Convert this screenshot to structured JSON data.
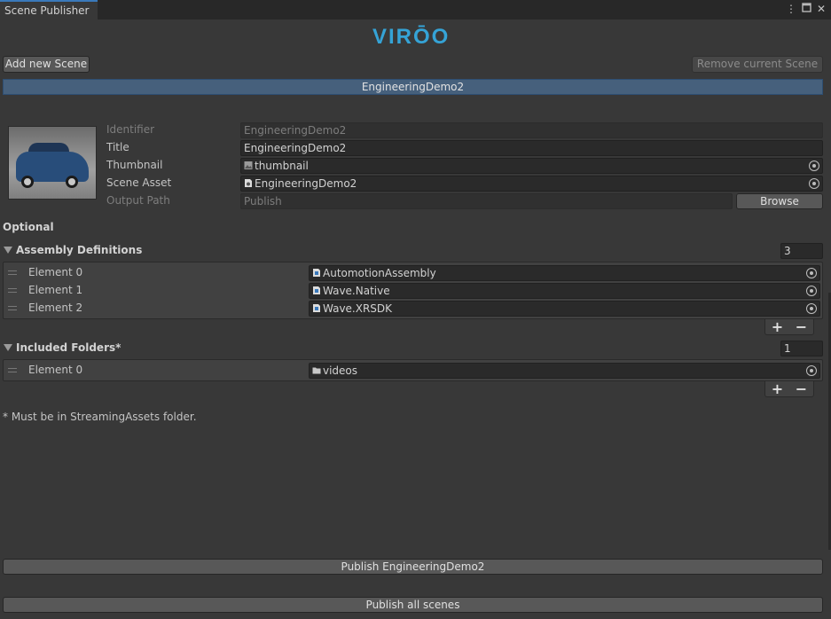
{
  "window": {
    "tab_label": "Scene Publisher",
    "menu_icon": "kebab-icon",
    "maximize_icon": "maximize-icon",
    "close_icon": "close-icon"
  },
  "logo": {
    "text": "VIRŌO",
    "color": "#35a3d6"
  },
  "toolbar": {
    "add_label": "Add new Scene",
    "remove_label": "Remove current Scene"
  },
  "scene_list": {
    "selected": "EngineeringDemo2"
  },
  "form": {
    "identifier_label": "Identifier",
    "identifier_value": "EngineeringDemo2",
    "title_label": "Title",
    "title_value": "EngineeringDemo2",
    "thumbnail_label": "Thumbnail",
    "thumbnail_value": "thumbnail",
    "scene_asset_label": "Scene Asset",
    "scene_asset_value": "EngineeringDemo2",
    "output_path_label": "Output Path",
    "output_path_placeholder": "Publish",
    "browse_label": "Browse"
  },
  "optional_label": "Optional",
  "assembly_definitions": {
    "label": "Assembly Definitions",
    "count": "3",
    "items": [
      {
        "label": "Element 0",
        "value": "AutomotionAssembly"
      },
      {
        "label": "Element 1",
        "value": "Wave.Native"
      },
      {
        "label": "Element 2",
        "value": "Wave.XRSDK"
      }
    ]
  },
  "included_folders": {
    "label": "Included Folders*",
    "count": "1",
    "items": [
      {
        "label": "Element 0",
        "value": "videos"
      }
    ],
    "note": "* Must be in StreamingAssets folder."
  },
  "list_controls": {
    "add": "+",
    "remove": "−"
  },
  "publish_current_label": "Publish EngineeringDemo2",
  "publish_all_label": "Publish all scenes",
  "colors": {
    "accent": "#3a79bb",
    "selection": "#46607c",
    "background": "#383838"
  }
}
